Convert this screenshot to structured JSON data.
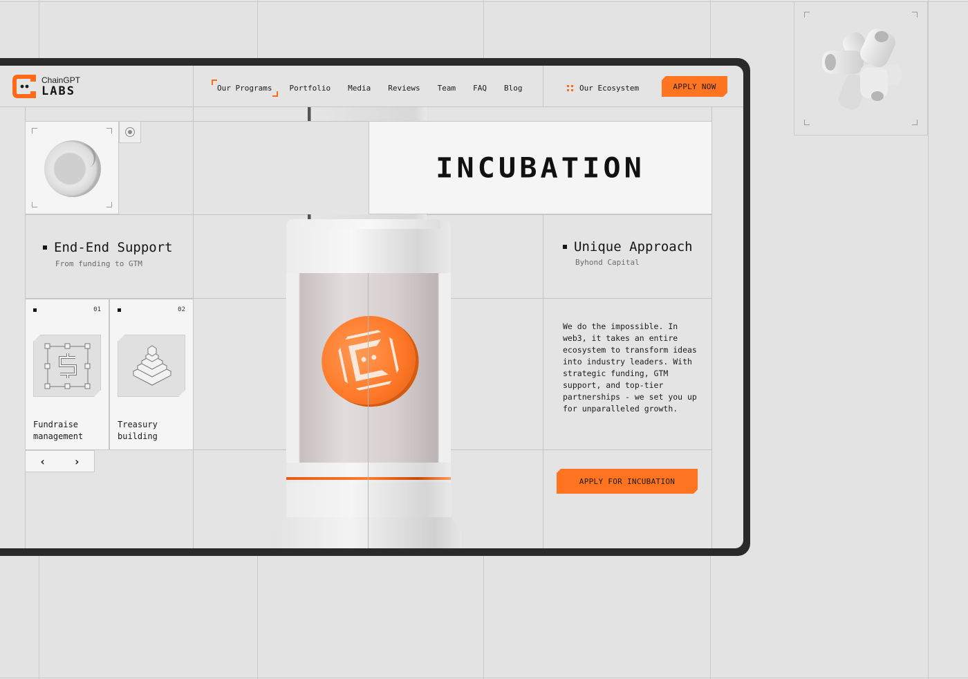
{
  "header": {
    "logo": {
      "top": "ChainGPT",
      "bottom": "LABS",
      "icon": "chaingpt-logo-icon"
    },
    "nav": [
      {
        "label": "Our Programs",
        "active": true
      },
      {
        "label": "Portfolio"
      },
      {
        "label": "Media"
      },
      {
        "label": "Reviews"
      },
      {
        "label": "Team"
      },
      {
        "label": "FAQ"
      },
      {
        "label": "Blog"
      }
    ],
    "ecosystem_label": "Our Ecosystem",
    "ecosystem_icon": "grid-dots-icon",
    "apply_now_label": "APPLY NOW"
  },
  "hero": {
    "title": "INCUBATION"
  },
  "features": {
    "left": {
      "title": "End-End Support",
      "subtitle": "From funding to GTM"
    },
    "right": {
      "title": "Unique Approach",
      "subtitle": "Byhond Capital"
    }
  },
  "services": [
    {
      "number": "01",
      "label_line1": "Fundraise",
      "label_line2": "management",
      "icon": "dollar-selection-icon"
    },
    {
      "number": "02",
      "label_line1": "Treasury",
      "label_line2": "building",
      "icon": "stacked-pyramid-icon"
    }
  ],
  "carousel": {
    "prev": "‹",
    "next": "›"
  },
  "description": "We do the impossible. In web3, it takes an entire ecosystem to transform ideas into industry leaders. With strategic funding, GTM support, and top-tier partnerships - we set you up for unparalleled growth.",
  "apply_incubation_label": "APPLY FOR INCUBATION",
  "colors": {
    "accent": "#ff7420",
    "background": "#e3e3e3",
    "card": "#f5f5f5",
    "frame": "#2a2a2a",
    "text": "#151515"
  }
}
